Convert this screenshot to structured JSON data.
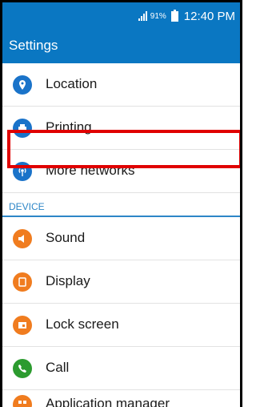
{
  "status_bar": {
    "battery": "91%",
    "time": "12:40 PM"
  },
  "app_bar": {
    "title": "Settings"
  },
  "items_top": [
    {
      "label": "Location",
      "icon": "location-pin-icon",
      "color": "#1a73c9"
    },
    {
      "label": "Printing",
      "icon": "printer-icon",
      "color": "#1a73c9"
    },
    {
      "label": "More networks",
      "icon": "antenna-icon",
      "color": "#1a73c9"
    }
  ],
  "section": {
    "label": "DEVICE"
  },
  "items_device": [
    {
      "label": "Sound",
      "icon": "speaker-icon",
      "color": "#f07c1f"
    },
    {
      "label": "Display",
      "icon": "display-icon",
      "color": "#f07c1f"
    },
    {
      "label": "Lock screen",
      "icon": "lock-screen-icon",
      "color": "#f07c1f"
    },
    {
      "label": "Call",
      "icon": "phone-icon",
      "color": "#2c9b2f"
    },
    {
      "label": "Application manager",
      "icon": "apps-icon",
      "color": "#f07c1f"
    }
  ]
}
